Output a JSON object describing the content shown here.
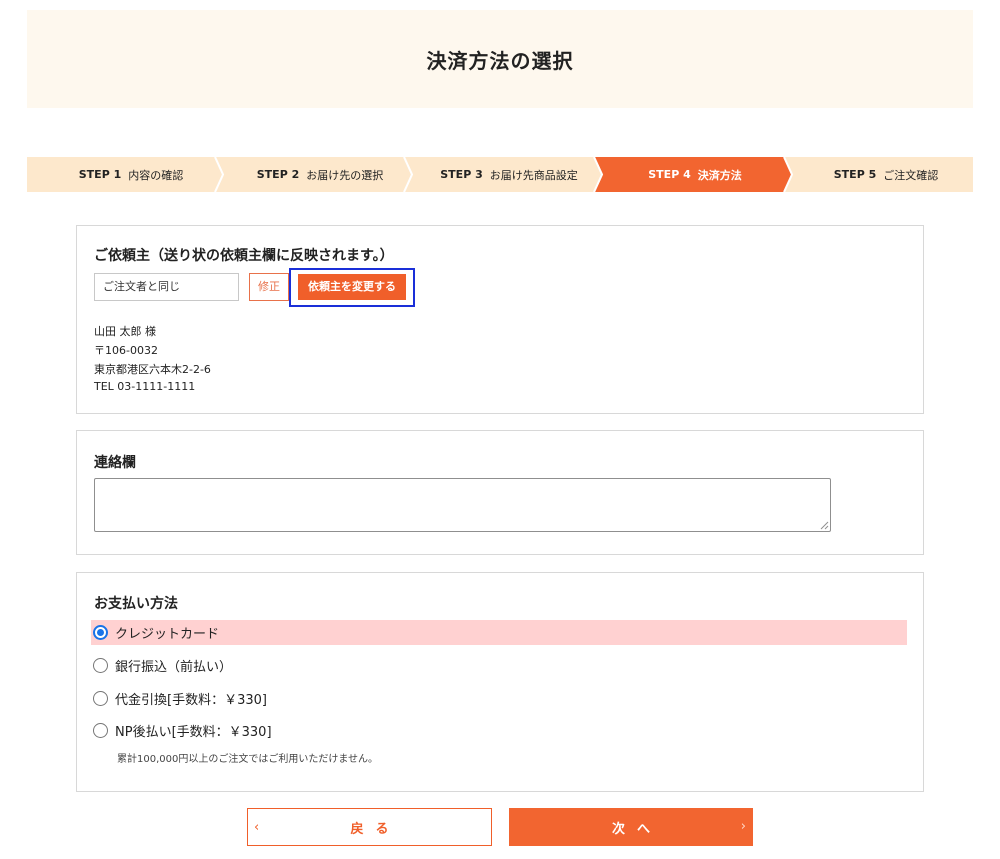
{
  "header": {
    "title": "決済方法の選択"
  },
  "colors": {
    "accent": "#f05f2a",
    "step_bg": "#fde8cc",
    "header_bg": "#fef8ee",
    "selected_row": "#ffd1d1",
    "focus_ring": "#1a2fd8"
  },
  "steps": [
    {
      "no": "STEP 1",
      "label": "内容の確認",
      "active": false
    },
    {
      "no": "STEP 2",
      "label": "お届け先の選択",
      "active": false
    },
    {
      "no": "STEP 3",
      "label": "お届け先商品設定",
      "active": false
    },
    {
      "no": "STEP 4",
      "label": "決済方法",
      "active": true
    },
    {
      "no": "STEP 5",
      "label": "ご注文確認",
      "active": false
    }
  ],
  "sender": {
    "title": "ご依頼主（送り状の依頼主欄に反映されます。）",
    "field_value": "ご注文者と同じ",
    "edit_label": "修正",
    "change_label": "依頼主を変更する",
    "name": "山田 太郎 様",
    "postal": "〒106-0032",
    "address": "東京都港区六本木2-2-6",
    "tel": "TEL 03-1111-1111"
  },
  "memo": {
    "title": "連絡欄",
    "value": ""
  },
  "payment": {
    "title": "お支払い方法",
    "options": [
      {
        "label": "クレジットカード",
        "selected": true
      },
      {
        "label": "銀行振込（前払い）",
        "selected": false
      },
      {
        "label": "代金引換[手数料：￥330]",
        "selected": false
      },
      {
        "label": "NP後払い[手数料：￥330]",
        "selected": false
      }
    ],
    "note": "累計100,000円以上のご注文ではご利用いただけません。"
  },
  "nav": {
    "back_label": "戻る",
    "next_label": "次へ",
    "back_icon": "chevron-left-icon",
    "next_icon": "chevron-right-icon"
  }
}
